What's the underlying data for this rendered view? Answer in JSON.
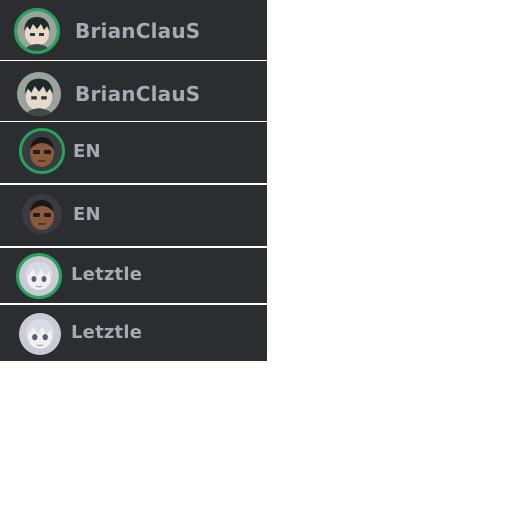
{
  "participants": [
    {
      "name": "BrianClauS",
      "avatar_icon": "anime-boy-avatar-icon",
      "speaking": true
    },
    {
      "name": "BrianClauS",
      "avatar_icon": "anime-boy-avatar-icon",
      "speaking": false
    },
    {
      "name": "EN",
      "avatar_icon": "person-photo-avatar-icon",
      "speaking": true
    },
    {
      "name": "EN",
      "avatar_icon": "person-photo-avatar-icon",
      "speaking": false
    },
    {
      "name": "Letztle",
      "avatar_icon": "anime-girl-avatar-icon",
      "speaking": true
    },
    {
      "name": "Letztle",
      "avatar_icon": "anime-girl-avatar-icon",
      "speaking": false
    }
  ],
  "colors": {
    "row_background": "#2b2d31",
    "speaking_ring": "#23a55a",
    "name_text": "#a7aab0",
    "page_background": "#ffffff"
  }
}
